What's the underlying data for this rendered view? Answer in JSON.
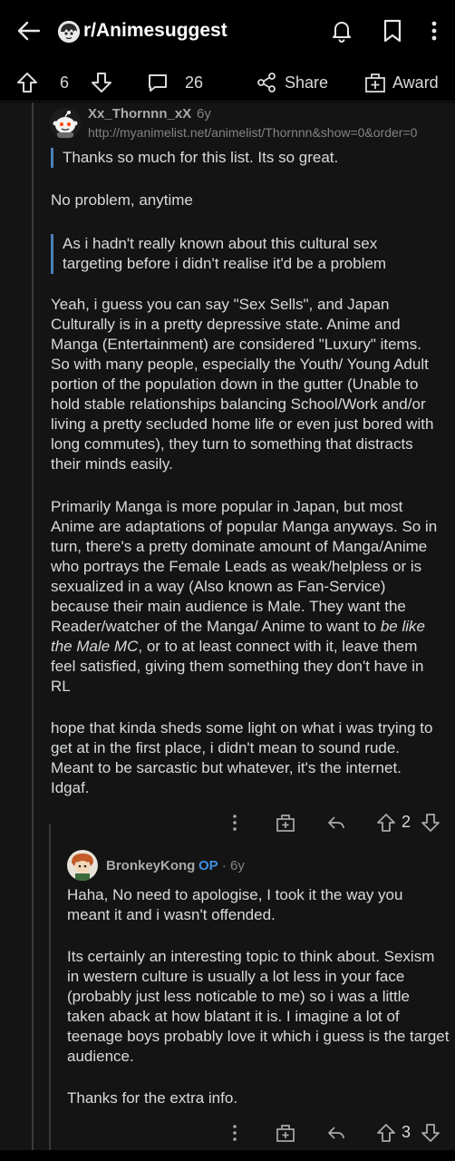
{
  "header": {
    "subreddit": "r/Animesuggest",
    "icons": [
      "back-arrow-icon",
      "notification-bell-icon",
      "bookmark-icon",
      "more-vertical-icon"
    ]
  },
  "actionbar": {
    "upvote_count": "6",
    "comment_count": "26",
    "share_label": "Share",
    "award_label": "Award"
  },
  "comments": [
    {
      "author": "Xx_Thornnn_xX",
      "age": "6y",
      "flair": "http://myanimelist.net/animelist/Thornnn&show=0&order=0",
      "quote1": "Thanks so much for this list. Its so great.",
      "p1": "No problem, anytime",
      "quote2": "As i hadn't really known about this cultural sex targeting before i didn't realise it'd be a problem",
      "p2": "Yeah, i guess you can say \"Sex Sells\", and Japan Culturally is in a pretty depressive state. Anime and Manga (Entertainment) are considered \"Luxury\" items. So with many people, especially the Youth/ Young Adult portion of the population down in the gutter (Unable to hold stable relationships balancing School/Work and/or living a pretty secluded home life or even just bored with long commutes), they turn to something that distracts their minds easily.",
      "p3_before": "Primarily Manga is more popular in Japan, but most Anime are adaptations of popular Manga anyways. So in turn, there's a pretty dominate amount of Manga/Anime who portrays the Female Leads as weak/helpless or is sexualized in a way (Also known as Fan-Service) because their main audience is Male. They want the Reader/watcher of the Manga/ Anime to want to ",
      "p3_em": "be like the Male MC",
      "p3_after": ", or to at least connect with it, leave them feel satisfied, giving them something they don't have in RL",
      "p4": "hope that kinda sheds some light on what i was trying to get at in the first place, i didn't mean to sound rude. Meant to be sarcastic but whatever, it's the internet. Idgaf.",
      "votes": "2"
    },
    {
      "author": "BronkeyKong",
      "op_badge": "OP",
      "age": "· 6y",
      "p1": "Haha, No need to apologise, I took it the way you meant it and i wasn't offended.",
      "p2": "Its certainly an interesting topic to think about. Sexism in western culture is usually a lot less in your face (probably just less noticable to me) so i was a little taken aback at how blatant it is. I imagine a lot of teenage boys probably love it which i guess is the target audience.",
      "p3": "Thanks for the extra info.",
      "votes": "3"
    }
  ],
  "colors": {
    "background": "#000000",
    "comment_bg": "#141414",
    "text": "#d7dadc",
    "muted": "#818384",
    "op_blue": "#3d8fe0",
    "quote_bar": "#4a7fb8"
  }
}
